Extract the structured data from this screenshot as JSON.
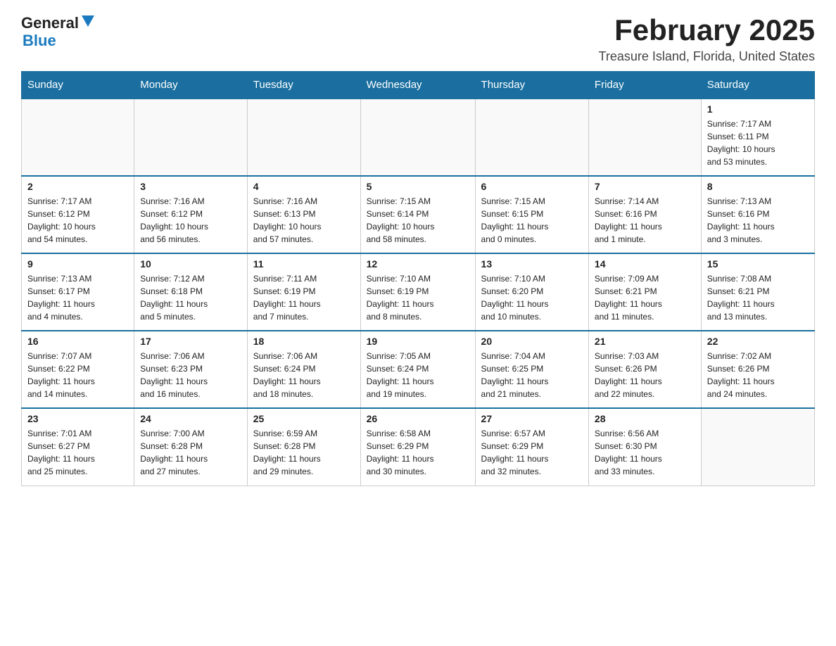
{
  "logo": {
    "general": "General",
    "blue": "Blue"
  },
  "title": "February 2025",
  "location": "Treasure Island, Florida, United States",
  "days_of_week": [
    "Sunday",
    "Monday",
    "Tuesday",
    "Wednesday",
    "Thursday",
    "Friday",
    "Saturday"
  ],
  "weeks": [
    [
      {
        "day": "",
        "info": ""
      },
      {
        "day": "",
        "info": ""
      },
      {
        "day": "",
        "info": ""
      },
      {
        "day": "",
        "info": ""
      },
      {
        "day": "",
        "info": ""
      },
      {
        "day": "",
        "info": ""
      },
      {
        "day": "1",
        "info": "Sunrise: 7:17 AM\nSunset: 6:11 PM\nDaylight: 10 hours\nand 53 minutes."
      }
    ],
    [
      {
        "day": "2",
        "info": "Sunrise: 7:17 AM\nSunset: 6:12 PM\nDaylight: 10 hours\nand 54 minutes."
      },
      {
        "day": "3",
        "info": "Sunrise: 7:16 AM\nSunset: 6:12 PM\nDaylight: 10 hours\nand 56 minutes."
      },
      {
        "day": "4",
        "info": "Sunrise: 7:16 AM\nSunset: 6:13 PM\nDaylight: 10 hours\nand 57 minutes."
      },
      {
        "day": "5",
        "info": "Sunrise: 7:15 AM\nSunset: 6:14 PM\nDaylight: 10 hours\nand 58 minutes."
      },
      {
        "day": "6",
        "info": "Sunrise: 7:15 AM\nSunset: 6:15 PM\nDaylight: 11 hours\nand 0 minutes."
      },
      {
        "day": "7",
        "info": "Sunrise: 7:14 AM\nSunset: 6:16 PM\nDaylight: 11 hours\nand 1 minute."
      },
      {
        "day": "8",
        "info": "Sunrise: 7:13 AM\nSunset: 6:16 PM\nDaylight: 11 hours\nand 3 minutes."
      }
    ],
    [
      {
        "day": "9",
        "info": "Sunrise: 7:13 AM\nSunset: 6:17 PM\nDaylight: 11 hours\nand 4 minutes."
      },
      {
        "day": "10",
        "info": "Sunrise: 7:12 AM\nSunset: 6:18 PM\nDaylight: 11 hours\nand 5 minutes."
      },
      {
        "day": "11",
        "info": "Sunrise: 7:11 AM\nSunset: 6:19 PM\nDaylight: 11 hours\nand 7 minutes."
      },
      {
        "day": "12",
        "info": "Sunrise: 7:10 AM\nSunset: 6:19 PM\nDaylight: 11 hours\nand 8 minutes."
      },
      {
        "day": "13",
        "info": "Sunrise: 7:10 AM\nSunset: 6:20 PM\nDaylight: 11 hours\nand 10 minutes."
      },
      {
        "day": "14",
        "info": "Sunrise: 7:09 AM\nSunset: 6:21 PM\nDaylight: 11 hours\nand 11 minutes."
      },
      {
        "day": "15",
        "info": "Sunrise: 7:08 AM\nSunset: 6:21 PM\nDaylight: 11 hours\nand 13 minutes."
      }
    ],
    [
      {
        "day": "16",
        "info": "Sunrise: 7:07 AM\nSunset: 6:22 PM\nDaylight: 11 hours\nand 14 minutes."
      },
      {
        "day": "17",
        "info": "Sunrise: 7:06 AM\nSunset: 6:23 PM\nDaylight: 11 hours\nand 16 minutes."
      },
      {
        "day": "18",
        "info": "Sunrise: 7:06 AM\nSunset: 6:24 PM\nDaylight: 11 hours\nand 18 minutes."
      },
      {
        "day": "19",
        "info": "Sunrise: 7:05 AM\nSunset: 6:24 PM\nDaylight: 11 hours\nand 19 minutes."
      },
      {
        "day": "20",
        "info": "Sunrise: 7:04 AM\nSunset: 6:25 PM\nDaylight: 11 hours\nand 21 minutes."
      },
      {
        "day": "21",
        "info": "Sunrise: 7:03 AM\nSunset: 6:26 PM\nDaylight: 11 hours\nand 22 minutes."
      },
      {
        "day": "22",
        "info": "Sunrise: 7:02 AM\nSunset: 6:26 PM\nDaylight: 11 hours\nand 24 minutes."
      }
    ],
    [
      {
        "day": "23",
        "info": "Sunrise: 7:01 AM\nSunset: 6:27 PM\nDaylight: 11 hours\nand 25 minutes."
      },
      {
        "day": "24",
        "info": "Sunrise: 7:00 AM\nSunset: 6:28 PM\nDaylight: 11 hours\nand 27 minutes."
      },
      {
        "day": "25",
        "info": "Sunrise: 6:59 AM\nSunset: 6:28 PM\nDaylight: 11 hours\nand 29 minutes."
      },
      {
        "day": "26",
        "info": "Sunrise: 6:58 AM\nSunset: 6:29 PM\nDaylight: 11 hours\nand 30 minutes."
      },
      {
        "day": "27",
        "info": "Sunrise: 6:57 AM\nSunset: 6:29 PM\nDaylight: 11 hours\nand 32 minutes."
      },
      {
        "day": "28",
        "info": "Sunrise: 6:56 AM\nSunset: 6:30 PM\nDaylight: 11 hours\nand 33 minutes."
      },
      {
        "day": "",
        "info": ""
      }
    ]
  ]
}
